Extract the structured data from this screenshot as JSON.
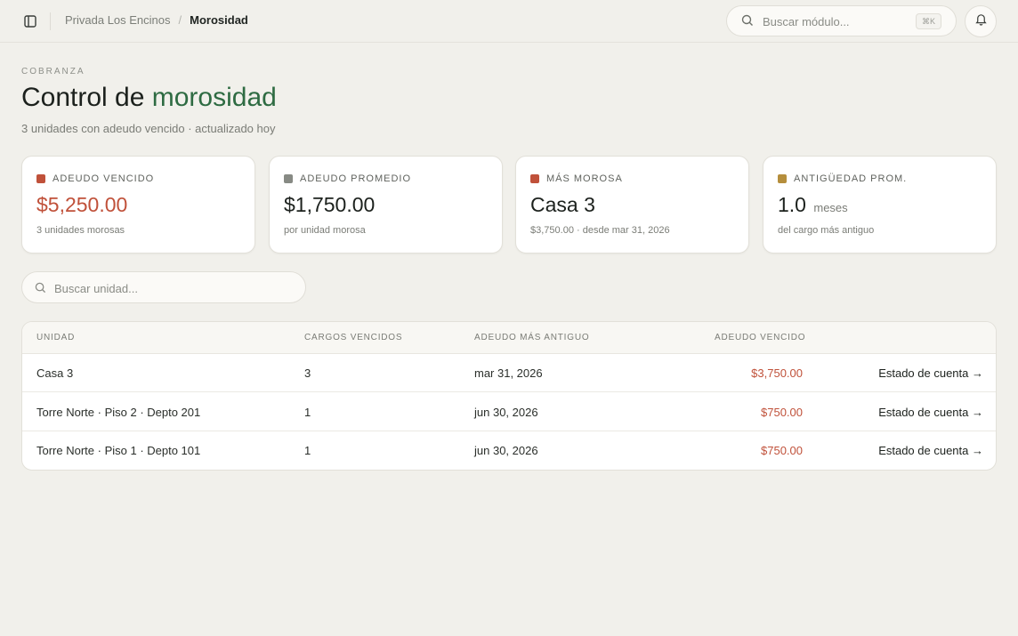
{
  "topbar": {
    "breadcrumb": {
      "parent": "Privada Los Encinos",
      "separator": "/",
      "current": "Morosidad"
    },
    "search": {
      "placeholder": "Buscar módulo...",
      "shortcut": "⌘K"
    }
  },
  "header": {
    "eyebrow": "COBRANZA",
    "title_main": "Control de ",
    "title_accent": "morosidad",
    "subtitle": "3 unidades con adeudo vencido · actualizado hoy"
  },
  "kpis": [
    {
      "label": "ADEUDO VENCIDO",
      "value": "$5,250.00",
      "unit": "",
      "note": "3 unidades morosas",
      "dot_color": "#c0513a"
    },
    {
      "label": "ADEUDO PROMEDIO",
      "value": "$1,750.00",
      "unit": "",
      "note": "por unidad morosa",
      "dot_color": "#878a84"
    },
    {
      "label": "MÁS MOROSA",
      "value": "Casa 3",
      "unit": "",
      "note": "$3,750.00 · desde mar 31, 2026",
      "dot_color": "#c0513a"
    },
    {
      "label": "ANTIGÜEDAD PROM.",
      "value": "1.0",
      "unit": "meses",
      "note": "del cargo más antiguo",
      "dot_color": "#b58e3c"
    }
  ],
  "unit_search": {
    "placeholder": "Buscar unidad..."
  },
  "table": {
    "columns": [
      "UNIDAD",
      "CARGOS VENCIDOS",
      "ADEUDO MÁS ANTIGUO",
      "ADEUDO VENCIDO"
    ],
    "rows": [
      {
        "unit": "Casa 3",
        "charges": "3",
        "oldest": "mar 31, 2026",
        "amount": "$3,750.00",
        "action": "Estado de cuenta →"
      },
      {
        "unit": "Torre Norte · Piso 2 · Depto 201",
        "charges": "1",
        "oldest": "jun 30, 2026",
        "amount": "$750.00",
        "action": "Estado de cuenta →"
      },
      {
        "unit": "Torre Norte · Piso 1 · Depto 101",
        "charges": "1",
        "oldest": "jun 30, 2026",
        "amount": "$750.00",
        "action": "Estado de cuenta →"
      }
    ]
  },
  "colors": {
    "accent_green": "#2e6b42",
    "danger": "#c0513a",
    "background": "#f1f0eb"
  }
}
